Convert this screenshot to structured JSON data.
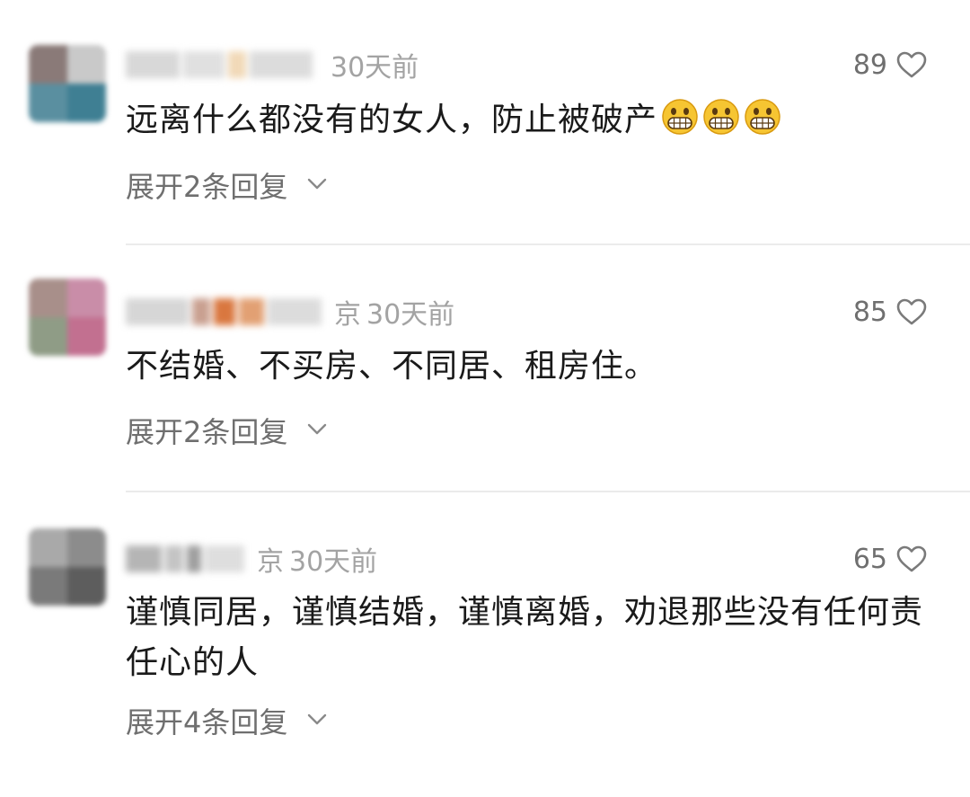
{
  "colors": {
    "meta_text": "#a3a3a3",
    "body_text": "#1a1a1a",
    "muted_text": "#6f6f6f",
    "divider": "#ebebeb"
  },
  "comments": [
    {
      "location": "",
      "time": "30天前",
      "likes": "89",
      "text": "远离什么都没有的女人，防止被破产",
      "emoji": [
        "grinning-face-icon",
        "grinning-face-icon",
        "grinning-face-icon"
      ],
      "expand_label": "展开2条回复"
    },
    {
      "location": "京",
      "time": "30天前",
      "likes": "85",
      "text": "不结婚、不买房、不同居、租房住。",
      "emoji": [],
      "expand_label": "展开2条回复"
    },
    {
      "location": "京",
      "time": "30天前",
      "likes": "65",
      "text": "谨慎同居，谨慎结婚，谨慎离婚，劝退那些没有任何责任心的人",
      "emoji": [],
      "expand_label": "展开4条回复"
    }
  ]
}
